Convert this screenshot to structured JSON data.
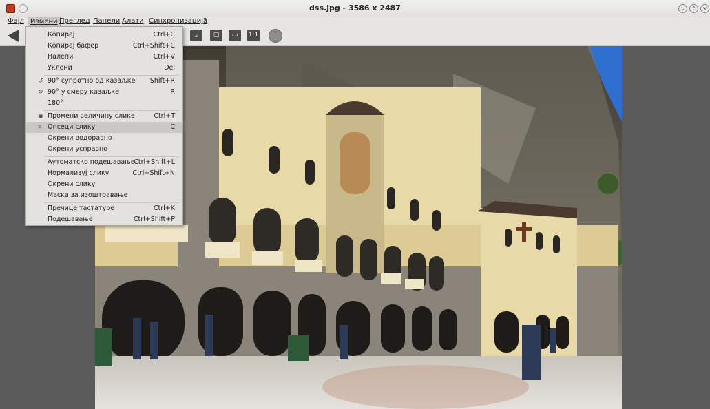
{
  "window": {
    "title": "dss.jpg  - 3586 x 2487",
    "controls": [
      "minimize-icon",
      "maximize-icon",
      "close-icon"
    ]
  },
  "menubar": {
    "items": [
      {
        "label": "Фајл"
      },
      {
        "label": "Измени",
        "active": true
      },
      {
        "label": "Преглед"
      },
      {
        "label": "Панели"
      },
      {
        "label": "Алати"
      },
      {
        "label": "Синхронизација"
      },
      {
        "label": "?"
      }
    ]
  },
  "toolbar": {
    "buttons": [
      "back-arrow-icon",
      "crop-icon",
      "fit-icon",
      "fit-width-icon",
      "actual-size-icon",
      "globe-icon"
    ],
    "actual_size_label": "1:1"
  },
  "edit_menu": {
    "items": [
      {
        "label": "Копирај",
        "shortcut": "Ctrl+C"
      },
      {
        "label": "Копирај бафер",
        "shortcut": "Ctrl+Shift+C"
      },
      {
        "label": "Налепи",
        "shortcut": "Ctrl+V"
      },
      {
        "label": "Уклони",
        "shortcut": "Del"
      },
      {
        "label": "90° супротно од казаљке",
        "shortcut": "Shift+R",
        "icon": "rotate-ccw-icon"
      },
      {
        "label": "90° у смеру казаљке",
        "shortcut": "R",
        "icon": "rotate-cw-icon"
      },
      {
        "label": "180°",
        "shortcut": ""
      },
      {
        "label": "Промени величину слике",
        "shortcut": "Ctrl+T",
        "icon": "resize-icon"
      },
      {
        "label": "Опсеци слику",
        "shortcut": "C",
        "icon": "crop-icon",
        "highlighted": true
      },
      {
        "label": "Окрени водоравно",
        "shortcut": ""
      },
      {
        "label": "Окрени усправно",
        "shortcut": ""
      },
      {
        "label": "Аутоматско подешавање",
        "shortcut": "Ctrl+Shift+L"
      },
      {
        "label": "Нормализуј слику",
        "shortcut": "Ctrl+Shift+N"
      },
      {
        "label": "Окрени слику",
        "shortcut": ""
      },
      {
        "label": "Маска за изоштравање",
        "shortcut": ""
      },
      {
        "label": "Пречице тастатуре",
        "shortcut": "Ctrl+K"
      },
      {
        "label": "Подешавање",
        "shortcut": "Ctrl+Shift+P"
      }
    ]
  },
  "colors": {
    "menu_bg": "#e3e2df",
    "highlight": "#c9c8c4",
    "canvas_bg": "#5a5a5a"
  }
}
